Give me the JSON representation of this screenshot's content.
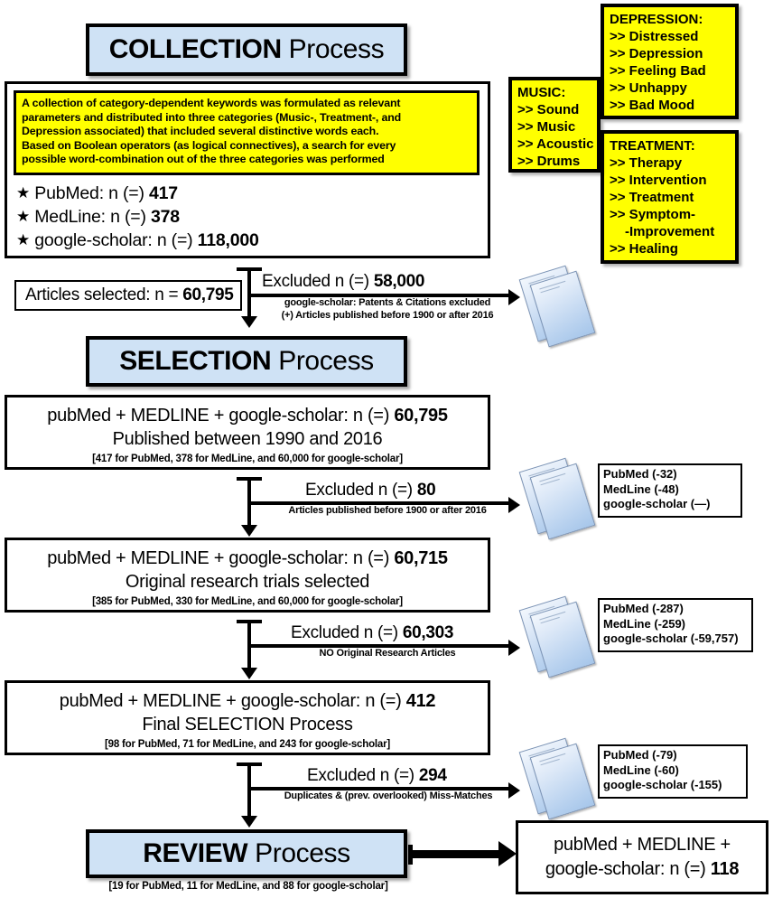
{
  "diagram": {
    "title": "Literature search and selection flow",
    "colors": {
      "banner_fill": "#cfe2f5",
      "keyword_fill": "#ffff00",
      "line": "#000000",
      "page_icon": "#b9d2ef"
    }
  },
  "collection": {
    "banner": {
      "strong": "COLLECTION",
      "rest": " Process"
    },
    "method_text": [
      "A collection of category-dependent keywords was formulated as relevant",
      "parameters and distributed into three categories (Music-, Treatment-, and",
      "Depression associated) that included several distinctive words each.",
      "Based on Boolean operators (as logical connectives), a search for every",
      "possible word-combination out of the three categories was performed"
    ],
    "sources": [
      {
        "bullet": "★",
        "label": "PubMed: n (=) ",
        "value": "417"
      },
      {
        "bullet": "★",
        "label": "MedLine: n (=) ",
        "value": "378"
      },
      {
        "bullet": "★",
        "label": "google-scholar: n (=) ",
        "value": "118,000"
      }
    ]
  },
  "keywords": {
    "music": {
      "title": "MUSIC:",
      "items": [
        ">> Sound",
        ">> Music",
        ">> Acoustic",
        ">> Drums"
      ]
    },
    "depression": {
      "title": "DEPRESSION:",
      "items": [
        ">> Distressed",
        ">> Depression",
        ">> Feeling Bad",
        ">> Unhappy",
        ">> Bad Mood"
      ]
    },
    "treatment": {
      "title": "TREATMENT:",
      "items": [
        ">> Therapy",
        ">> Intervention",
        ">> Treatment",
        ">> Symptom-",
        "-Improvement",
        ">> Healing"
      ]
    }
  },
  "articles_selected": {
    "label": "Articles selected: n = ",
    "value": "60,795"
  },
  "exclusions": {
    "collection": {
      "main_label": "Excluded n (=) ",
      "main_value": "58,000",
      "sub": [
        "google-scholar: Patents & Citations excluded",
        "(+) Articles published before 1900 or after 2016"
      ]
    },
    "step1": {
      "main_label": "Excluded n (=) ",
      "main_value": "80",
      "sub": [
        "Articles published before 1900 or after 2016"
      ],
      "note": [
        "PubMed (-32)",
        "MedLine (-48)",
        "google-scholar (—)"
      ]
    },
    "step2": {
      "main_label": "Excluded n (=) ",
      "main_value": "60,303",
      "sub": [
        "NO Original Research Articles"
      ],
      "note": [
        "PubMed (-287)",
        "MedLine (-259)",
        "google-scholar (-59,757)"
      ]
    },
    "step3": {
      "main_label": "Excluded n (=) ",
      "main_value": "294",
      "sub": [
        "Duplicates & (prev. overlooked) Miss-Matches"
      ],
      "note": [
        "PubMed (-79)",
        "MedLine (-60)",
        "google-scholar (-155)"
      ]
    }
  },
  "selection": {
    "banner": {
      "strong": "SELECTION",
      "rest": " Process"
    },
    "stages": [
      {
        "line1_label": "pubMed + MEDLINE + google-scholar: n (=) ",
        "line1_value": "60,795",
        "line2": "Published between 1990 and 2016",
        "line3": "[417 for PubMed, 378 for MedLine, and 60,000 for google-scholar]"
      },
      {
        "line1_label": "pubMed + MEDLINE + google-scholar: n (=) ",
        "line1_value": "60,715",
        "line2": "Original research trials selected",
        "line3": "[385 for PubMed, 330 for MedLine, and 60,000 for google-scholar]"
      },
      {
        "line1_label": "pubMed + MEDLINE + google-scholar: n (=) ",
        "line1_value": "412",
        "line2": "Final SELECTION Process",
        "line3": "[98 for PubMed, 71 for MedLine, and 243 for google-scholar]"
      }
    ]
  },
  "review": {
    "banner": {
      "strong": "REVIEW",
      "rest": " Process"
    },
    "sub": "[19 for PubMed, 11 for MedLine, and 88 for google-scholar]",
    "result": {
      "line1": "pubMed + MEDLINE +",
      "line2_label": "google-scholar: n (=) ",
      "line2_value": "118"
    }
  }
}
